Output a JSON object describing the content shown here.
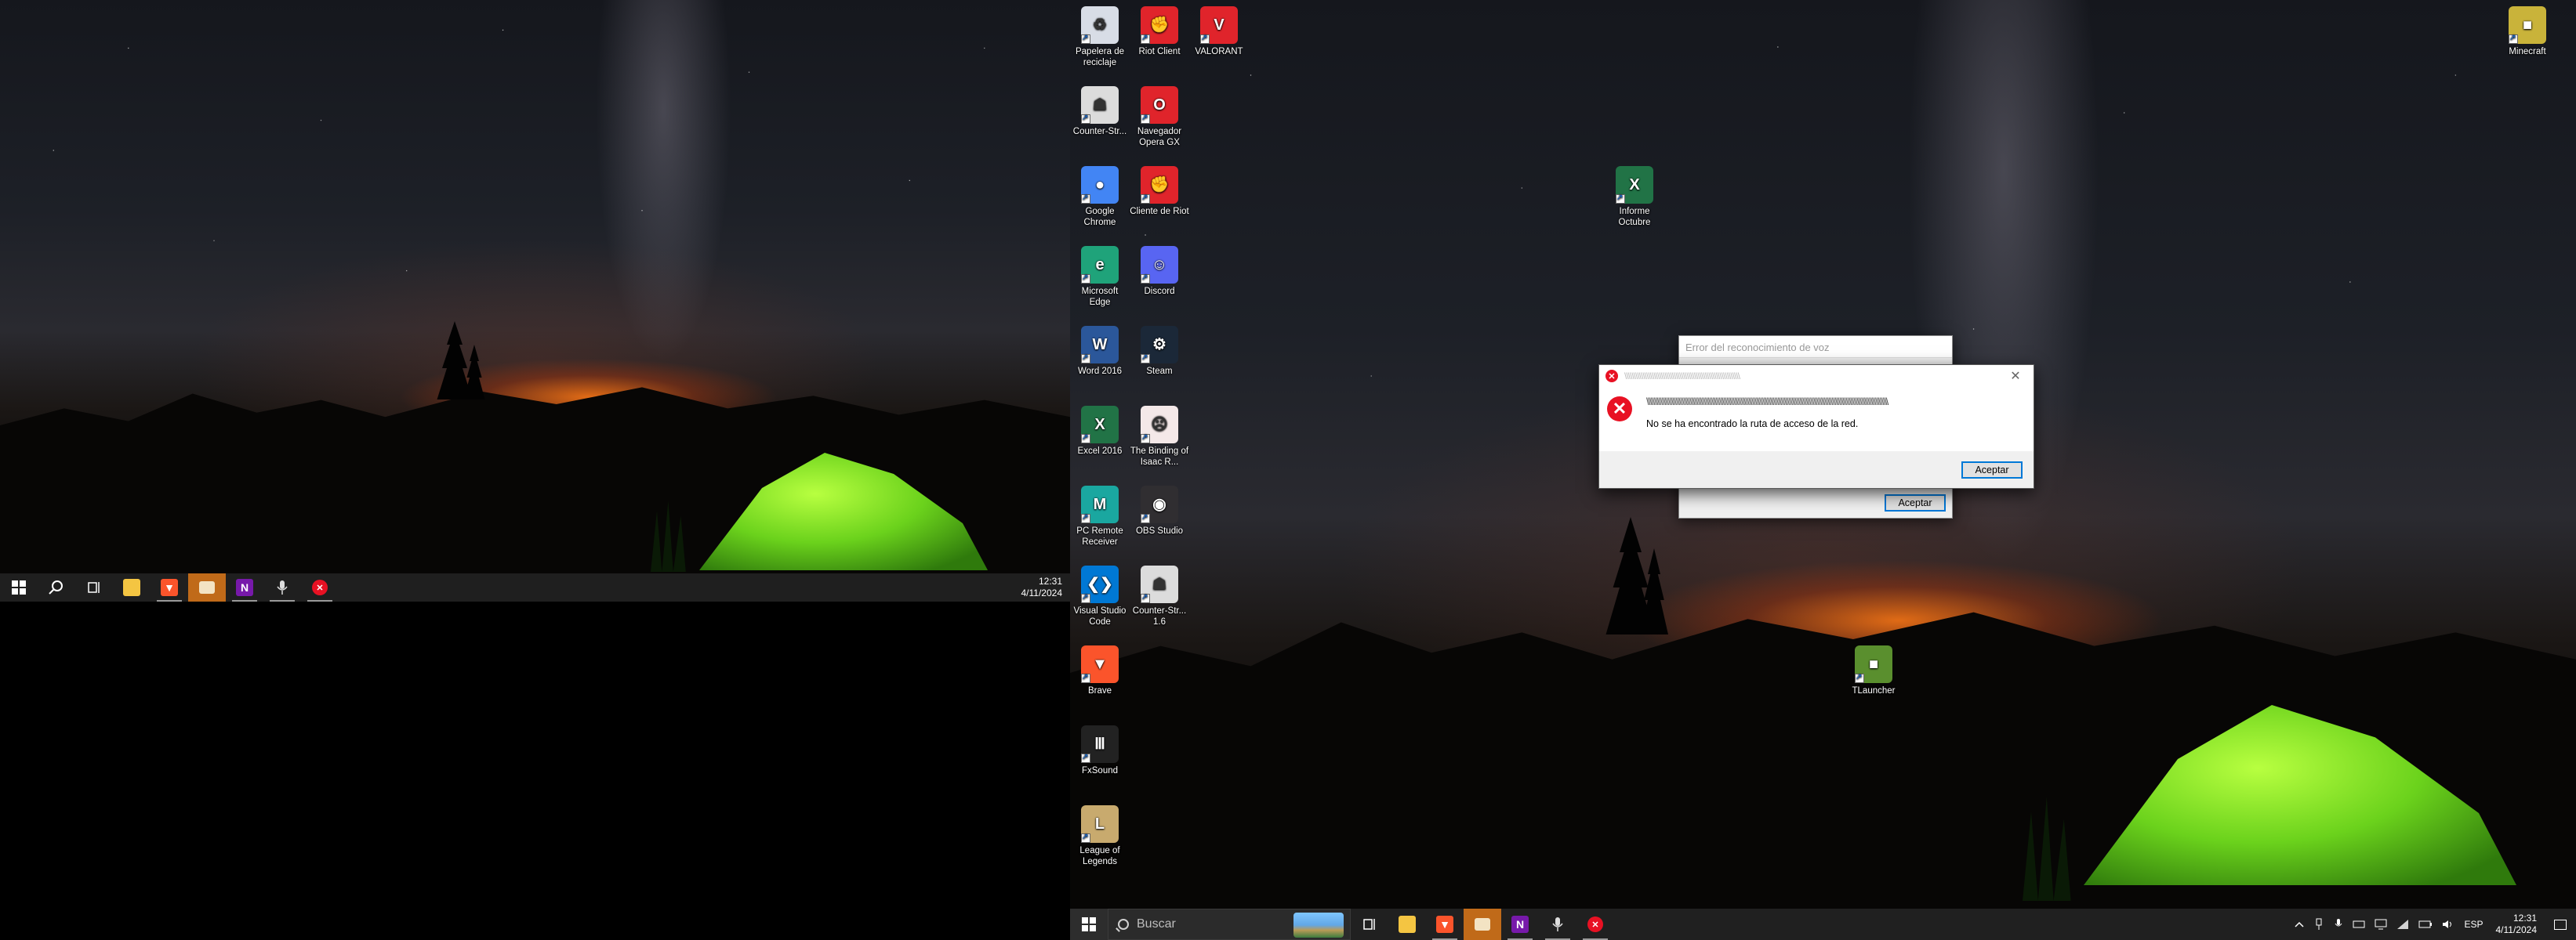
{
  "left_monitor": {
    "taskbar": {
      "start": "start",
      "buttons": [
        "search-icon",
        "task-view-icon",
        "file-explorer-icon",
        "brave-icon",
        "app-window-icon",
        "onenote-icon",
        "voice-icon",
        "error-icon"
      ],
      "clock_time": "12:31",
      "clock_date": "4/11/2024"
    }
  },
  "right_monitor": {
    "taskbar": {
      "search_placeholder": "Buscar",
      "language": "ESP",
      "clock_time": "12:31",
      "clock_date": "4/11/2024"
    }
  },
  "desktop_icons": [
    {
      "label": "Papelera de reciclaje",
      "icon": "recycle-bin-icon",
      "color": "#d8dde6"
    },
    {
      "label": "Riot Client",
      "icon": "riot-client-icon",
      "color": "#e0242b"
    },
    {
      "label": "VALORANT",
      "icon": "valorant-icon",
      "color": "#e0242b"
    },
    {
      "label": "Counter-Str...",
      "icon": "counter-strike-icon",
      "color": "#dcdcdc"
    },
    {
      "label": "Navegador Opera GX",
      "icon": "opera-gx-icon",
      "color": "#e0242b"
    },
    {
      "label": "Google Chrome",
      "icon": "chrome-icon",
      "color": "#4285f4"
    },
    {
      "label": "Cliente de Riot",
      "icon": "riot-client-icon",
      "color": "#e0242b"
    },
    {
      "label": "Microsoft Edge",
      "icon": "edge-icon",
      "color": "#1fa37a"
    },
    {
      "label": "Discord",
      "icon": "discord-icon",
      "color": "#5865f2"
    },
    {
      "label": "Word 2016",
      "icon": "word-icon",
      "color": "#2b579a"
    },
    {
      "label": "Steam",
      "icon": "steam-icon",
      "color": "#1b2838"
    },
    {
      "label": "Excel 2016",
      "icon": "excel-icon",
      "color": "#217346"
    },
    {
      "label": "The Binding of Isaac R...",
      "icon": "isaac-icon",
      "color": "#f4e8e8"
    },
    {
      "label": "PC Remote Receiver",
      "icon": "pc-remote-icon",
      "color": "#1aa7a0"
    },
    {
      "label": "OBS Studio",
      "icon": "obs-icon",
      "color": "#302e31"
    },
    {
      "label": "Visual Studio Code",
      "icon": "vscode-icon",
      "color": "#0078d4"
    },
    {
      "label": "Counter-Str... 1.6",
      "icon": "counter-strike-icon",
      "color": "#dcdcdc"
    },
    {
      "label": "Brave",
      "icon": "brave-icon",
      "color": "#fb542b"
    },
    {
      "label": "FxSound",
      "icon": "fxsound-icon",
      "color": "#222222"
    },
    {
      "label": "League of Legends",
      "icon": "league-icon",
      "color": "#c8aa6e"
    },
    {
      "label": "Informe Octubre",
      "icon": "excel-file-icon",
      "color": "#217346"
    },
    {
      "label": "TLauncher",
      "icon": "tlauncher-icon",
      "color": "#5a8f2e"
    },
    {
      "label": "Minecraft",
      "icon": "minecraft-icon",
      "color": "#c9b33a"
    }
  ],
  "dialog_back": {
    "title": "Error del reconocimiento de voz",
    "ok_label": "Aceptar"
  },
  "dialog_front": {
    "title_garbled": "\\\\\\\\\\\\\\\\\\\\\\\\\\\\\\\\\\\\\\\\\\\\\\\\\\\\\\\\\\\\\\\\\\\\\\\\\\\\\\\\\\\\\\\\\\\\\\\\\\\\\\\\\\\\\\\\\\\\\\\\\\\\\\",
    "body_garbled": "\\\\\\\\\\\\\\\\\\\\\\\\\\\\\\\\\\\\\\\\\\\\\\\\\\\\\\\\\\\\\\\\\\\\\\\\\\\\\\\\\\\\\\\\\\\\\\\\\\\\\\\\\\\\\\\\\\\\\\\\\\\\\\\\\\\\\\\\\\\\\\\\\\\\\\\\\\\\\\\\\\\\\\\\\\\\\\\\\\\\\\\\\\\\\\\\\\\\\\\\\\\\\\\\\\\\\\\\\\\\\\\\\\\\\\\\\\\\\\\\\\\\\\\\\\\\\\\\\\\\\\\\\\\\\\\\\\\\\\\\\\\\\\\\\\\\\\\\\\\\\\\\\\\\\\\\",
    "message": "No se ha encontrado la ruta de acceso de la red.",
    "ok_label": "Aceptar"
  }
}
